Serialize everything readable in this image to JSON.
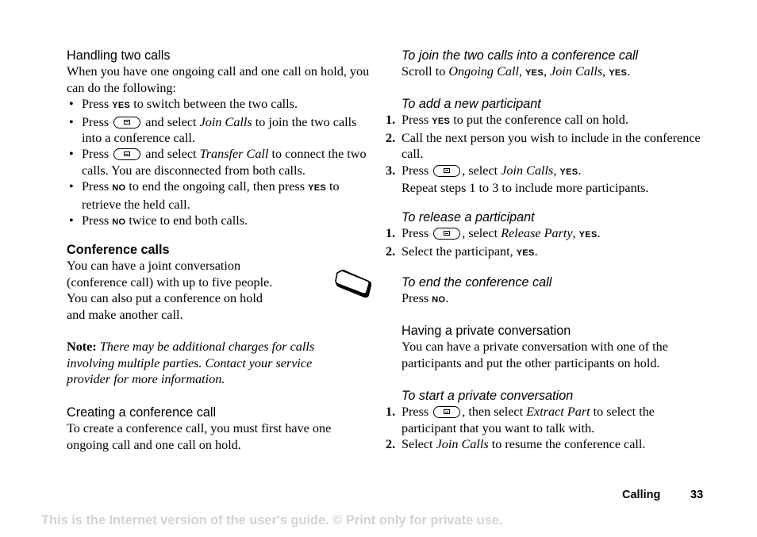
{
  "left": {
    "handling": {
      "heading": "Handling two calls",
      "intro": "When you have one ongoing call and one call on hold, you can do the following:",
      "bullets": [
        {
          "pre": "Press ",
          "key": "YES",
          "post": " to switch between the two calls."
        },
        {
          "pre": "Press ",
          "icon": "menu-key-icon",
          "mid": " and select ",
          "ital": "Join Calls",
          "post": " to join the two calls into a conference call."
        },
        {
          "pre": "Press ",
          "icon": "menu-key-icon",
          "mid": " and select ",
          "ital": "Transfer Call",
          "post": " to connect the two calls. You are disconnected from both calls."
        },
        {
          "pre": "Press ",
          "key": "NO",
          "mid": " to end the ongoing call, then press ",
          "key2": "YES",
          "post": " to retrieve the held call."
        },
        {
          "pre": "Press ",
          "key": "NO",
          "post": " twice to end both calls."
        }
      ]
    },
    "conference": {
      "heading": "Conference calls",
      "body": "You can have a joint conversation (conference call) with up to five people. You can also put a conference on hold and make another call.",
      "lines": [
        "You can have a joint conversation",
        "(conference call) with up to five people.",
        "You can also put a conference on hold",
        "and make another call."
      ],
      "note_label": "Note:",
      "note_text": " There may be additional charges for calls involving multiple parties. Contact your service provider for more information."
    },
    "creating": {
      "heading": "Creating a conference call",
      "body": "To create a conference call, you must first have one ongoing call and one call on hold."
    }
  },
  "right": {
    "join": {
      "heading": "To join the two calls into a conference call",
      "pre": "Scroll to ",
      "ital1": "Ongoing Call",
      "sep1": ", ",
      "key1": "YES",
      "sep2": ", ",
      "ital2": "Join Calls",
      "sep3": ", ",
      "key2": "YES",
      "end": "."
    },
    "add": {
      "heading": "To add a new participant",
      "steps": [
        {
          "num": "1.",
          "pre": "Press ",
          "key": "YES",
          "post": " to put the conference call on hold."
        },
        {
          "num": "2.",
          "text": "Call the next person you wish to include in the conference call."
        },
        {
          "num": "3.",
          "pre": "Press ",
          "mid": ", select ",
          "ital": "Join Calls",
          "sep": ", ",
          "key": "YES",
          "post": ".",
          "extra": "Repeat steps 1 to 3 to include more participants."
        }
      ]
    },
    "release": {
      "heading": "To release a participant",
      "steps": [
        {
          "num": "1.",
          "pre": "Press ",
          "mid": ", select ",
          "ital": "Release Party",
          "sep": ", ",
          "key": "YES",
          "post": "."
        },
        {
          "num": "2.",
          "pre": "Select the participant, ",
          "key": "YES",
          "post": "."
        }
      ]
    },
    "end": {
      "heading": "To end the conference call",
      "pre": "Press ",
      "key": "NO",
      "post": "."
    },
    "private": {
      "heading": "Having a private conversation",
      "body": "You can have a private conversation with one of the participants and put the other participants on hold."
    },
    "start_private": {
      "heading": "To start a private conversation",
      "steps": [
        {
          "num": "1.",
          "pre": "Press ",
          "mid": ", then select ",
          "ital": "Extract Part",
          "post": " to select the participant that you want to talk with."
        },
        {
          "num": "2.",
          "pre": "Select ",
          "ital": "Join Calls",
          "post": " to resume the conference call."
        }
      ]
    }
  },
  "footer": {
    "section": "Calling",
    "page": "33",
    "watermark": "This is the Internet version of the user's guide. © Print only for private use."
  },
  "colors": {
    "text": "#000000",
    "watermark": "#d3d3d3"
  }
}
